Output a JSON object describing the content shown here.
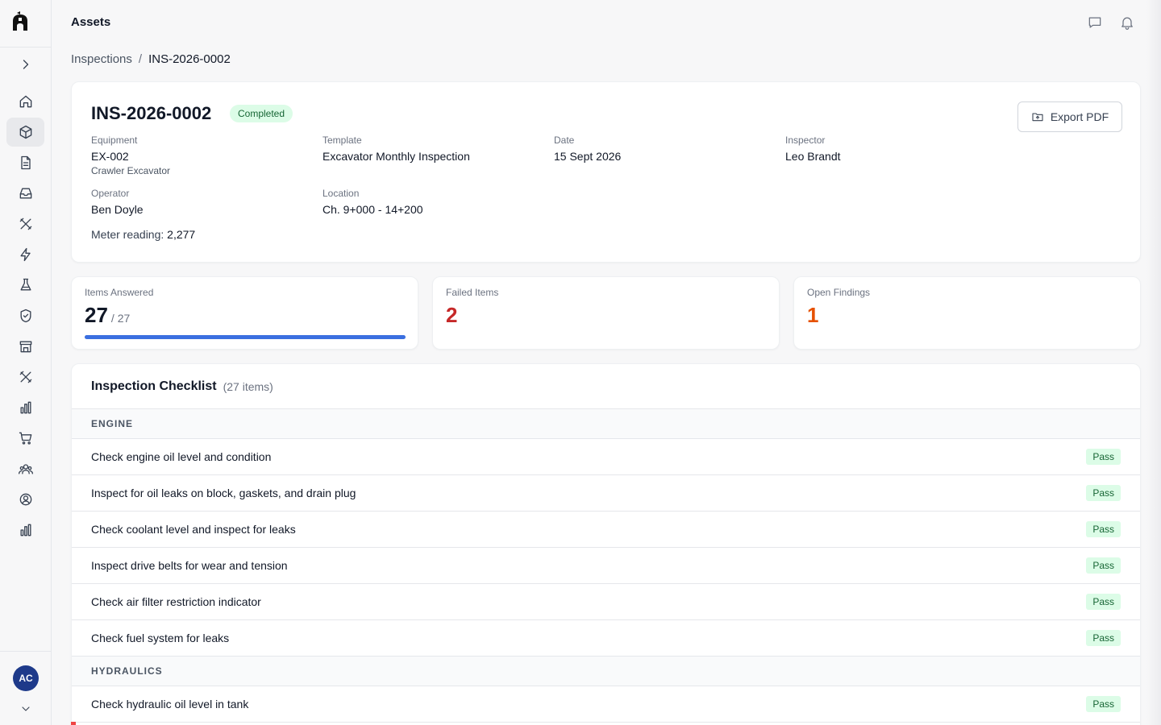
{
  "app": {
    "section_title": "Assets"
  },
  "breadcrumb": {
    "parent": "Inspections",
    "separator": "/",
    "current": "INS-2026-0002"
  },
  "inspection": {
    "id": "INS-2026-0002",
    "status": "Completed",
    "export_label": "Export PDF",
    "equipment_label": "Equipment",
    "equipment_value": "EX-002",
    "equipment_sub": "Crawler Excavator",
    "template_label": "Template",
    "template_value": "Excavator Monthly Inspection",
    "date_label": "Date",
    "date_value": "15 Sept 2026",
    "inspector_label": "Inspector",
    "inspector_value": "Leo Brandt",
    "operator_label": "Operator",
    "operator_value": "Ben Doyle",
    "location_label": "Location",
    "location_value": "Ch. 9+000 - 14+200",
    "meter_label": "Meter reading:",
    "meter_value": "2,277"
  },
  "stats": {
    "answered": {
      "label": "Items Answered",
      "value": "27",
      "total": "/ 27",
      "progress": 1.0
    },
    "failed": {
      "label": "Failed Items",
      "value": "2"
    },
    "findings": {
      "label": "Open Findings",
      "value": "1"
    }
  },
  "checklist": {
    "title": "Inspection Checklist",
    "count": "(27 items)",
    "sections": [
      {
        "name": "ENGINE",
        "items": [
          {
            "text": "Check engine oil level and condition",
            "result": "Pass"
          },
          {
            "text": "Inspect for oil leaks on block, gaskets, and drain plug",
            "result": "Pass"
          },
          {
            "text": "Check coolant level and inspect for leaks",
            "result": "Pass"
          },
          {
            "text": "Inspect drive belts for wear and tension",
            "result": "Pass"
          },
          {
            "text": "Check air filter restriction indicator",
            "result": "Pass"
          },
          {
            "text": "Check fuel system for leaks",
            "result": "Pass"
          }
        ]
      },
      {
        "name": "HYDRAULICS",
        "items": [
          {
            "text": "Check hydraulic oil level in tank",
            "result": "Pass"
          }
        ]
      }
    ]
  },
  "user": {
    "initials": "AC"
  },
  "colors": {
    "accent": "#3b6fe0",
    "failed": "#c62828",
    "findings": "#e65100",
    "pass_bg": "#dcfce7",
    "pass_text": "#166534",
    "avatar": "#1e3a8a"
  },
  "icons": {
    "sidebar": [
      "chevron-right-icon",
      "home-icon",
      "cube-icon",
      "document-icon",
      "inbox-icon",
      "tools-icon",
      "bolt-icon",
      "flask-icon",
      "shield-check-icon",
      "store-icon",
      "tools-icon",
      "bar-chart-icon",
      "cart-icon",
      "users-icon",
      "user-circle-icon",
      "bar-chart-icon"
    ],
    "top": [
      "chat-icon",
      "bell-icon"
    ]
  }
}
